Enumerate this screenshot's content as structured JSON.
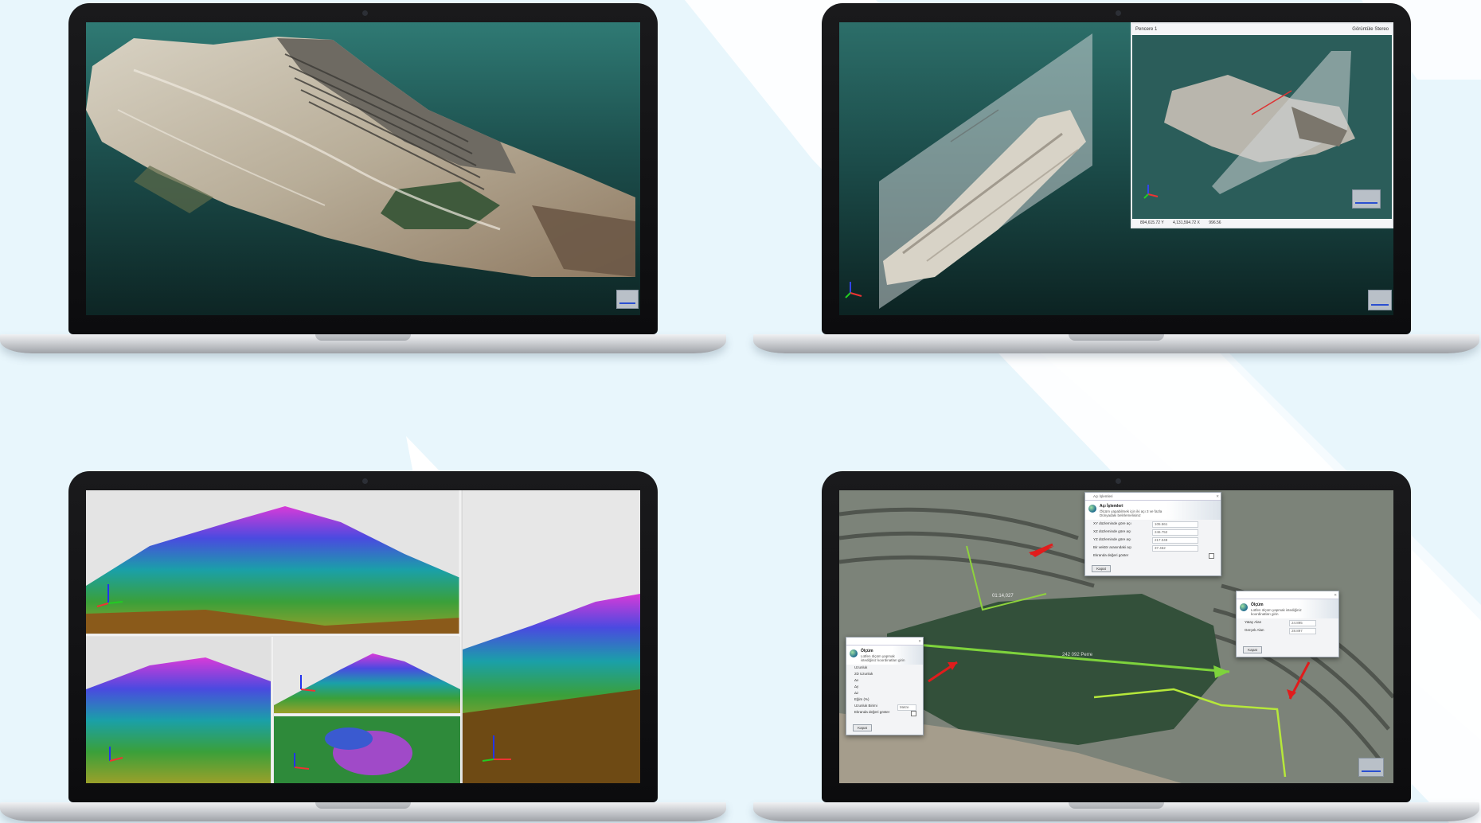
{
  "page": {
    "background_color": "#e8f6fc",
    "stripe_color": "#ffffff"
  },
  "laptops": [
    {
      "scene": "open-pit-mine-3d-model",
      "screen_background": "#1e4e4c"
    },
    {
      "scene": "mine-model-with-section-plane",
      "screen_background": "#1e4e4c",
      "sub_window": {
        "title": "Pencere 1",
        "menu": "Görüntüle   Stereo",
        "status": [
          "894,615.72 Y",
          "4,131,594.72 X",
          "996.56"
        ]
      }
    },
    {
      "scene": "elevation-colored-mountain-views"
    },
    {
      "scene": "mine-pit-aerial-measurement",
      "annotations": [
        "01:14,027",
        "242 092 Perre"
      ],
      "dialogs": [
        {
          "name": "area-operations",
          "title": "Açı İşlemleri",
          "heading": "Açı İşlemleri",
          "subheading": "Ölçüm yapabilmek için iki açı 3 ve fazla Dünyadaki belirlemelisiniz",
          "rows": [
            {
              "label": "XY düzleminde göre açı",
              "value": "105.561"
            },
            {
              "label": "XZ düzleminde göre açı",
              "value": "246.752"
            },
            {
              "label": "YZ düzleminde göre açı",
              "value": "217.049"
            },
            {
              "label": "Bir vektör arasındaki açı",
              "value": "37.462"
            },
            {
              "label": "Ekranda değeri göster",
              "value": ""
            }
          ],
          "button": "Kapat"
        },
        {
          "name": "measurement",
          "title": "Ölçüm",
          "heading": "Ölçüm",
          "subheading": "Lütfen ölçüm yapmak istediğiniz koordinatları girin",
          "rows": [
            {
              "label": "Yatay Alan",
              "value": "24.895"
            },
            {
              "label": "Gerçek Alan",
              "value": "28.897"
            }
          ],
          "button": "Kapat"
        },
        {
          "name": "measurement-left",
          "title": "Ölçüm",
          "heading": "Ölçüm",
          "subheading": "Lütfen ölçüm yapmak istediğiniz koordinatları girin",
          "rows": [
            {
              "label": "Uzunluk",
              "value": ""
            },
            {
              "label": "2D Uzunluk",
              "value": ""
            },
            {
              "label": "Δx",
              "value": ""
            },
            {
              "label": "Δy",
              "value": ""
            },
            {
              "label": "Δz",
              "value": ""
            },
            {
              "label": "Eğim (%)",
              "value": ""
            },
            {
              "label": "Uzunluk Birimi",
              "value": "Metre"
            },
            {
              "label": "Ekranda değeri göster",
              "value": ""
            }
          ],
          "button": "Kapat"
        }
      ]
    }
  ]
}
